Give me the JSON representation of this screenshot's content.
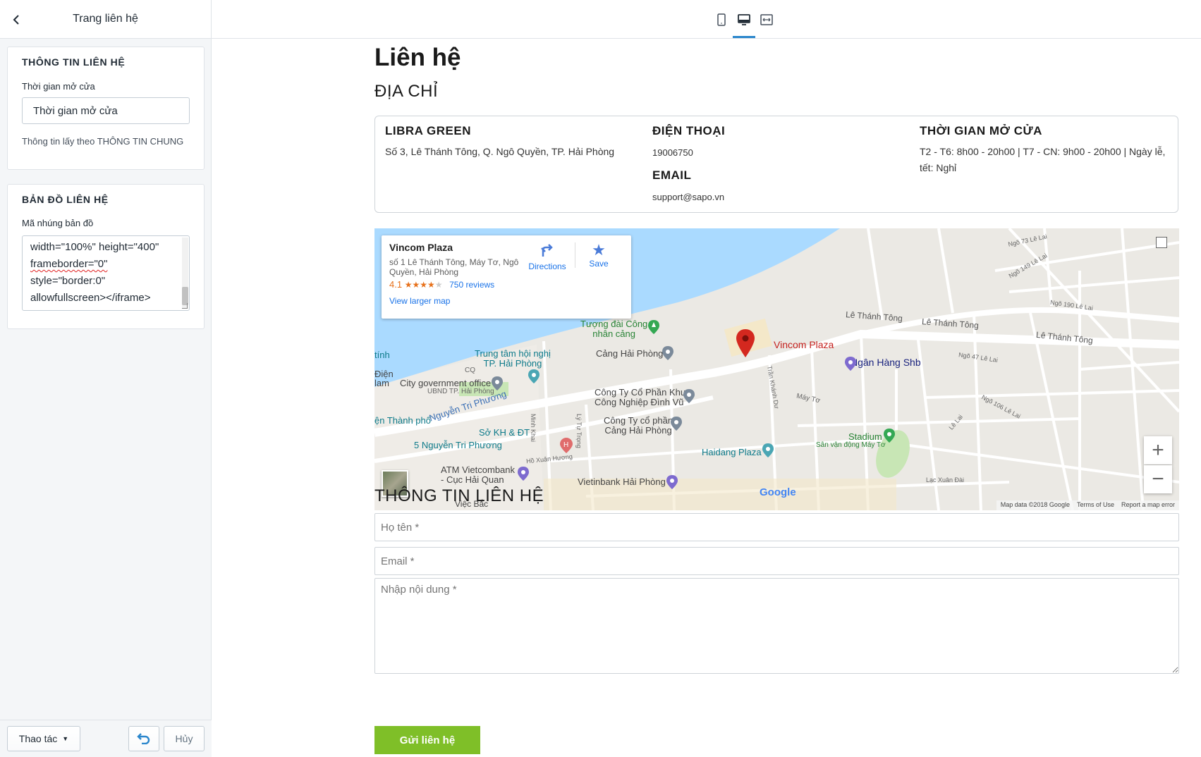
{
  "sidebar": {
    "title": "Trang liên hệ",
    "contact_card": {
      "heading": "THÔNG TIN LIÊN HỆ",
      "opening_label": "Thời gian mở cửa",
      "opening_value": "Thời gian mở cửa",
      "help": "Thông tin lấy theo THÔNG TIN CHUNG"
    },
    "map_card": {
      "heading": "BẢN ĐỒ LIÊN HỆ",
      "embed_label": "Mã nhúng bản đồ",
      "code_lines": [
        "width=\"100%\" height=\"400\"",
        "frameborder=\"0\"",
        "style=\"border:0\"",
        "allowfullscreen></iframe>"
      ]
    },
    "footer": {
      "actions_label": "Thao tác",
      "cancel_label": "Hủy"
    }
  },
  "topbar": {
    "devices": [
      "mobile-icon",
      "desktop-icon",
      "fullwidth-icon"
    ],
    "active_device": "desktop-icon"
  },
  "page": {
    "title": "Liên hệ",
    "address_heading": "ĐỊA CHỈ",
    "company": "LIBRA GREEN",
    "address": "Số 3, Lê Thánh Tông, Q. Ngô Quyền, TP. Hải Phòng",
    "phone_heading": "ĐIỆN THOẠI",
    "phone": "19006750",
    "email_heading": "EMAIL",
    "email": "support@sapo.vn",
    "hours_heading": "THỜI GIAN MỞ CỬA",
    "hours": "T2 - T6: 8h00 - 20h00 | T7 - CN: 9h00 - 20h00 | Ngày lễ, tết: Nghỉ",
    "form_heading": "THÔNG TIN LIÊN HỆ",
    "name_placeholder": "Họ tên *",
    "email_placeholder": "Email *",
    "message_placeholder": "Nhập nội dung *",
    "submit_label": "Gửi liên hệ"
  },
  "map": {
    "place_name": "Vincom Plaza",
    "place_address": "số 1 Lê Thánh Tông, Máy Tơ, Ngô Quyền, Hải Phòng",
    "rating": "4.1",
    "stars": "★★★★",
    "star_empty": "★",
    "reviews": "750 reviews",
    "larger_map": "View larger map",
    "directions": "Directions",
    "save": "Save",
    "labels": {
      "tuong_dai": "Tượng đài Công",
      "tuong_dai_2": "nhân cảng",
      "trung_tam": "Trung tâm hội nghị",
      "trung_tam_2": "TP. Hải Phòng",
      "cang": "Cảng Hải Phòng",
      "vincom": "Vincom Plaza",
      "ngan_hang": "Ngân Hàng Shb",
      "city_gov": "City government office",
      "ubnd": "UBND TP. Hải Phòng",
      "cty_khu": "Công Ty Cổ Phần Khu",
      "cty_khu_2": "Công Nghiệp Đình Vũ",
      "cty_cang": "Công Ty cổ phần",
      "cty_cang_2": "Cảng Hải Phòng",
      "nguyen_tri_phuong": "Nguyễn Tri Phương",
      "so_kh": "Sở KH & ĐT",
      "five_ntp": "5 Nguyễn Tri Phương",
      "thanh_pho": "ện Thành phố",
      "haidang": "Haidang Plaza",
      "stadium": "Stadium",
      "san_van_dong": "Sân vận động Máy Tơ",
      "atm": "ATM Vietcombank",
      "cuc_hai_quan": "- Cục Hải Quan",
      "vietinbank": "Vietinbank Hải Phòng",
      "le_thanh_tong": "Lê Thánh Tông",
      "le_thanh_tong_2": "Lê Thánh Tông",
      "le_thanh_tong_3": "Lê Thánh Tông",
      "ngo73": "Ngõ 73 Lê Lai",
      "ngo149": "Ngõ 149 Lê Lai",
      "ngo190": "Ngõ 190 Lê Lai",
      "ngo47": "Ngõ 47 Lê Lai",
      "ngo106": "Ngõ 106 Lê Lai",
      "may_to": "Máy Tơ",
      "ho_xuan_huong": "Hồ Xuân Hương",
      "minh_khai": "Minh Khai",
      "ly_tu_trong": "Lý Tự Trọng",
      "tran_khanh_du": "Trần Khánh Dư",
      "le_lai": "Lê Lai",
      "lac_xuan_dai": "Lạc Xuân Đài",
      "tinh": "tính",
      "dien": "Điện",
      "lam": "lam",
      "co": "CQ",
      "viec_bac": "Việc Bắc",
      "google": "Google",
      "map_data": "Map data ©2018 Google",
      "terms": "Terms of Use",
      "report": "Report a map error"
    }
  },
  "colors": {
    "accent_blue": "#2a86cc",
    "submit_green": "#7fbf28",
    "water": "#aadaff",
    "pin_red": "#d4281f"
  }
}
